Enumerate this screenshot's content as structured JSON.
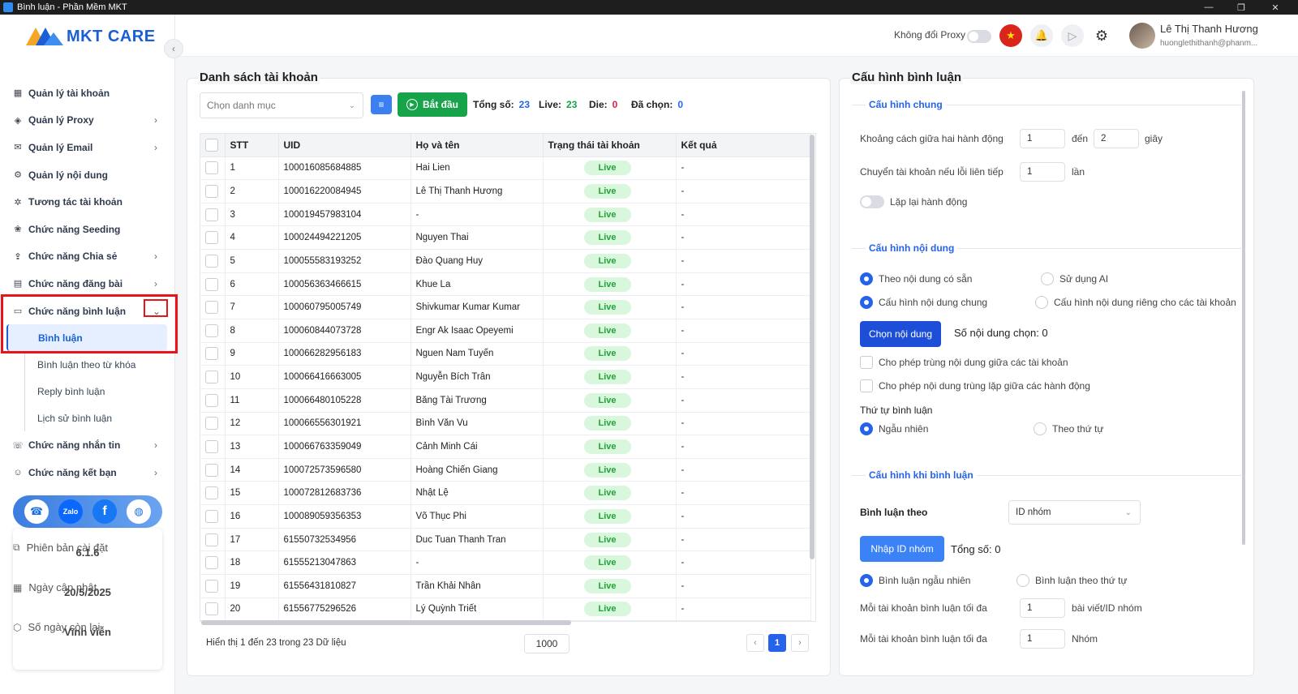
{
  "window": {
    "title": "Bình luận - Phần Mềm MKT",
    "min": "—",
    "max": "❐",
    "close": "✕"
  },
  "brand": {
    "name": "MKT CARE",
    "colors": {
      "primary": "#1a5fd6",
      "accent": "#f5a623"
    }
  },
  "sidebar": {
    "collapse_icon": "‹",
    "items": [
      {
        "label": "Quản lý tài khoản",
        "icon": "grid-icon",
        "glyph": "▦",
        "chevron": ""
      },
      {
        "label": "Quản lý Proxy",
        "icon": "layers-icon",
        "glyph": "◈",
        "chevron": "›"
      },
      {
        "label": "Quản lý Email",
        "icon": "mail-icon",
        "glyph": "✉",
        "chevron": "›"
      },
      {
        "label": "Quản lý nội dung",
        "icon": "content-icon",
        "glyph": "⚙",
        "chevron": ""
      },
      {
        "label": "Tương tác tài khoản",
        "icon": "interact-icon",
        "glyph": "✲",
        "chevron": ""
      },
      {
        "label": "Chức năng Seeding",
        "icon": "seeding-icon",
        "glyph": "❀",
        "chevron": ""
      },
      {
        "label": "Chức năng Chia sẻ",
        "icon": "share-icon",
        "glyph": "⇪",
        "chevron": "›"
      },
      {
        "label": "Chức năng đăng bài",
        "icon": "post-icon",
        "glyph": "▤",
        "chevron": "›"
      }
    ],
    "comment_menu": {
      "label": "Chức năng bình luận",
      "icon_glyph": "▭",
      "chevron": "⌄",
      "subs": [
        "Bình luận",
        "Bình luận theo từ khóa",
        "Reply bình luận",
        "Lịch sử bình luận"
      ]
    },
    "items_after": [
      {
        "label": "Chức năng nhắn tin",
        "icon": "message-icon",
        "glyph": "☏",
        "chevron": "›"
      },
      {
        "label": "Chức năng kết bạn",
        "icon": "add-friend-icon",
        "glyph": "☺",
        "chevron": "›"
      }
    ],
    "social": {
      "support": "☎",
      "zalo": "Zalo",
      "facebook": "f",
      "web": "◍"
    },
    "info": {
      "version_label": "Phiên bản cài đặt",
      "version_value": "6.1.6",
      "update_label": "Ngày cập nhật",
      "update_value": "20/5/2025",
      "days_label": "Số ngày còn lại",
      "days_value": "Vĩnh viễn",
      "icons": {
        "version": "⧉",
        "update": "▦",
        "days": "⬡"
      }
    }
  },
  "header": {
    "proxy_label": "Không đổi Proxy",
    "flag": "★",
    "bell": "🔔",
    "play": "▷",
    "gear": "⚙",
    "user_name": "Lê Thị Thanh Hương",
    "user_email": "huonglethithanh@phanm..."
  },
  "accounts": {
    "title": "Danh sách tài khoản",
    "category_placeholder": "Chọn danh mục",
    "dropdown_glyph": "⌄",
    "filter_glyph": "≡",
    "start_label": "Bắt đầu",
    "play_glyph": "▶",
    "stats": {
      "total_label": "Tổng số:",
      "total": "23",
      "live_label": "Live:",
      "live": "23",
      "die_label": "Die:",
      "die": "0",
      "selected_label": "Đã chọn:",
      "selected": "0"
    },
    "stat_colors": {
      "total": "#2563eb",
      "live": "#16a34a",
      "die": "#e11d48",
      "selected": "#2563eb"
    },
    "columns": [
      "STT",
      "UID",
      "Họ và tên",
      "Trạng thái tài khoản",
      "Kết quả"
    ],
    "rows": [
      {
        "stt": "1",
        "uid": "100016085684885",
        "name": "Hai Lien",
        "status": "Live",
        "result": "-"
      },
      {
        "stt": "2",
        "uid": "100016220084945",
        "name": "Lê Thị Thanh Hương",
        "status": "Live",
        "result": "-"
      },
      {
        "stt": "3",
        "uid": "100019457983104",
        "name": "-",
        "status": "Live",
        "result": "-"
      },
      {
        "stt": "4",
        "uid": "100024494221205",
        "name": "Nguyen Thai",
        "status": "Live",
        "result": "-"
      },
      {
        "stt": "5",
        "uid": "100055583193252",
        "name": "Đào Quang Huy",
        "status": "Live",
        "result": "-"
      },
      {
        "stt": "6",
        "uid": "100056363466615",
        "name": "Khue La",
        "status": "Live",
        "result": "-"
      },
      {
        "stt": "7",
        "uid": "100060795005749",
        "name": "Shivkumar Kumar Kumar",
        "status": "Live",
        "result": "-"
      },
      {
        "stt": "8",
        "uid": "100060844073728",
        "name": "Engr Ak Isaac Opeyemi",
        "status": "Live",
        "result": "-"
      },
      {
        "stt": "9",
        "uid": "100066282956183",
        "name": "Nguen Nam Tuyến",
        "status": "Live",
        "result": "-"
      },
      {
        "stt": "10",
        "uid": "100066416663005",
        "name": "Nguyễn Bích Trân",
        "status": "Live",
        "result": "-"
      },
      {
        "stt": "11",
        "uid": "100066480105228",
        "name": "Băng Tài Trương",
        "status": "Live",
        "result": "-"
      },
      {
        "stt": "12",
        "uid": "100066556301921",
        "name": "Bình Văn Vu",
        "status": "Live",
        "result": "-"
      },
      {
        "stt": "13",
        "uid": "100066763359049",
        "name": "Cảnh Minh Cái",
        "status": "Live",
        "result": "-"
      },
      {
        "stt": "14",
        "uid": "100072573596580",
        "name": "Hoàng Chiến Giang",
        "status": "Live",
        "result": "-"
      },
      {
        "stt": "15",
        "uid": "100072812683736",
        "name": "Nhật Lệ",
        "status": "Live",
        "result": "-"
      },
      {
        "stt": "16",
        "uid": "100089059356353",
        "name": "Võ Thục Phi",
        "status": "Live",
        "result": "-"
      },
      {
        "stt": "17",
        "uid": "61550732534956",
        "name": "Duc Tuan Thanh Tran",
        "status": "Live",
        "result": "-"
      },
      {
        "stt": "18",
        "uid": "61555213047863",
        "name": "-",
        "status": "Live",
        "result": "-"
      },
      {
        "stt": "19",
        "uid": "61556431810827",
        "name": "Trần Khải Nhân",
        "status": "Live",
        "result": "-"
      },
      {
        "stt": "20",
        "uid": "61556775296526",
        "name": "Lý Quỳnh Triết",
        "status": "Live",
        "result": "-"
      }
    ],
    "footer": "Hiển thị 1 đến 23 trong 23 Dữ liệu",
    "page_size": "1000",
    "pagination": {
      "prev": "‹",
      "current": "1",
      "next": "›"
    }
  },
  "config": {
    "title": "Cấu hình bình luận",
    "general": {
      "title": "Cấu hình chung",
      "delay_label": "Khoảng cách giữa hai hành động",
      "delay_from": "1",
      "to_label": "đến",
      "delay_to": "2",
      "seconds_label": "giây",
      "switch_label": "Chuyển tài khoản nếu lỗi liên tiếp",
      "switch_value": "1",
      "times_label": "lần",
      "repeat_label": "Lặp lại hành động"
    },
    "content": {
      "title": "Cấu hình nội dung",
      "opt_available": "Theo nội dung có sẵn",
      "opt_ai": "Sử dụng AI",
      "opt_common": "Cấu hình nội dung chung",
      "opt_per_account": "Cấu hình nội dung riêng cho các tài khoản",
      "choose_button": "Chọn nội dung",
      "count_label": "Số nội dung chọn: 0",
      "allow_dup_accounts": "Cho phép trùng nội dung giữa các tài khoản",
      "allow_dup_actions": "Cho phép nội dung trùng lặp giữa các hành động",
      "order_label": "Thứ tự bình luận",
      "order_random": "Ngẫu nhiên",
      "order_sequence": "Theo thứ tự"
    },
    "on_comment": {
      "title": "Cấu hình khi bình luận",
      "comment_by_label": "Bình luận theo",
      "comment_by_value": "ID nhóm",
      "import_button": "Nhập ID nhóm",
      "total_label": "Tổng số: 0",
      "opt_random": "Bình luận ngẫu nhiên",
      "opt_sequence": "Bình luận theo thứ tự",
      "max_per_post_label": "Mỗi tài khoản bình luận tối đa",
      "max_per_post_value": "1",
      "max_per_post_unit": "bài viết/ID nhóm",
      "max_groups_label": "Mỗi tài khoản bình luận tối đa",
      "max_groups_value": "1",
      "max_groups_unit": "Nhóm"
    }
  }
}
